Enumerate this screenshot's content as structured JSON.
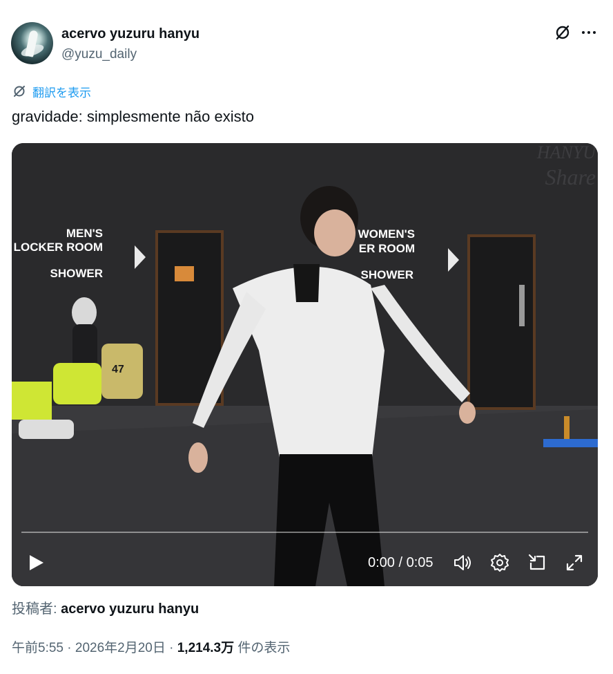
{
  "author": {
    "display_name": "acervo yuzuru hanyu",
    "handle": "@yuzu_daily"
  },
  "translate_label": "翻訳を表示",
  "tweet_text": "gravidade: simplesmente não existo",
  "video": {
    "scene_signs": {
      "mens_line1": "MEN'S",
      "mens_line2": "LOCKER ROOM",
      "shower_left": "SHOWER",
      "womens_line1": "WOMEN'S",
      "womens_line2": "ER ROOM",
      "shower_right": "SHOWER",
      "watermark_line1": "HANYU",
      "watermark_line2": "Share",
      "bib_number": "47"
    },
    "time_current": "0:00",
    "time_separator": " / ",
    "time_total": "0:05",
    "progress": 0.0
  },
  "posted_by_label": "投稿者: ",
  "posted_by_name": "acervo yuzuru hanyu",
  "meta": {
    "time": "午前5:55",
    "sep1": " · ",
    "date": "2026年2月20日",
    "sep2": " · ",
    "views_count": "1,214.3万",
    "views_label": " 件の表示"
  },
  "icons": [
    "grok-icon",
    "more-icon",
    "translate-icon",
    "play-icon",
    "volume-icon",
    "settings-icon",
    "pip-icon",
    "fullscreen-icon"
  ]
}
